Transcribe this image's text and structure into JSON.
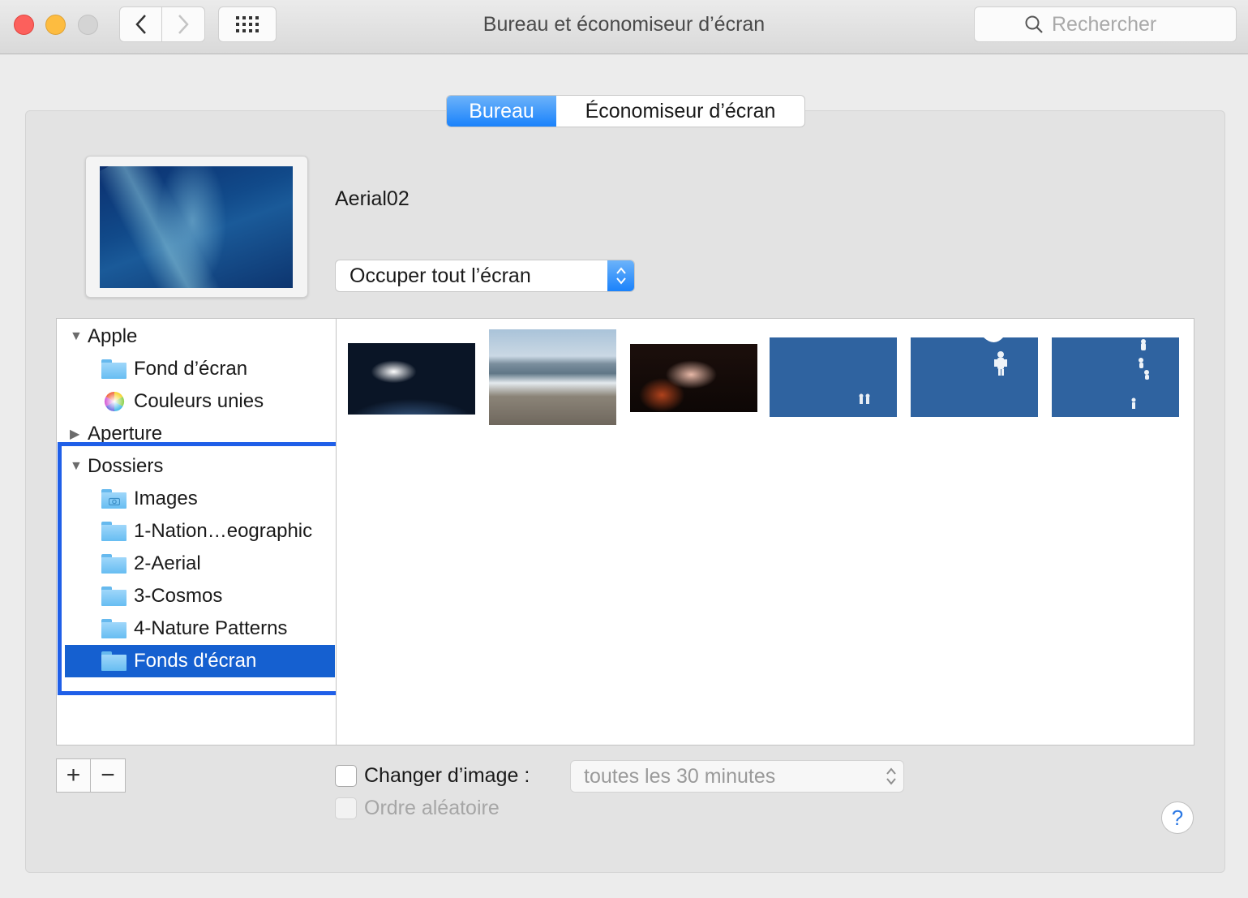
{
  "window": {
    "title": "Bureau et économiseur d’écran",
    "search_placeholder": "Rechercher"
  },
  "tabs": [
    {
      "label": "Bureau",
      "active": true
    },
    {
      "label": "Économiseur d’écran",
      "active": false
    }
  ],
  "current_picture": {
    "name": "Aerial02",
    "fit_mode": "Occuper tout l’écran"
  },
  "sidebar": {
    "groups": [
      {
        "label": "Apple",
        "expanded": true,
        "items": [
          {
            "label": "Fond d’écran",
            "icon": "folder-icon"
          },
          {
            "label": "Couleurs unies",
            "icon": "color-wheel-icon"
          }
        ]
      },
      {
        "label": "Aperture",
        "expanded": false,
        "items": []
      },
      {
        "label": "Dossiers",
        "expanded": true,
        "items": [
          {
            "label": "Images",
            "icon": "pictures-folder-icon"
          },
          {
            "label": "1-Nation…eographic",
            "icon": "folder-icon"
          },
          {
            "label": "2-Aerial",
            "icon": "folder-icon"
          },
          {
            "label": "3-Cosmos",
            "icon": "folder-icon"
          },
          {
            "label": "4-Nature Patterns",
            "icon": "folder-icon"
          },
          {
            "label": "Fonds d'écran",
            "icon": "folder-icon",
            "selected": true
          }
        ]
      }
    ]
  },
  "thumbnails": [
    "earth-sunrise",
    "beach-waves",
    "guitar-hands",
    "blue-figures-1",
    "blue-figures-2",
    "blue-figures-3"
  ],
  "controls": {
    "plus_label": "+",
    "minus_label": "−",
    "change_image_label": "Changer d’image :",
    "change_image_checked": false,
    "interval": "toutes les 30 minutes",
    "random_order_label": "Ordre aléatoire",
    "random_order_enabled": false,
    "help_label": "?"
  },
  "colors": {
    "accent": "#1a82fb",
    "selection": "#1560d0",
    "annotation_box": "#1f5fe8"
  }
}
